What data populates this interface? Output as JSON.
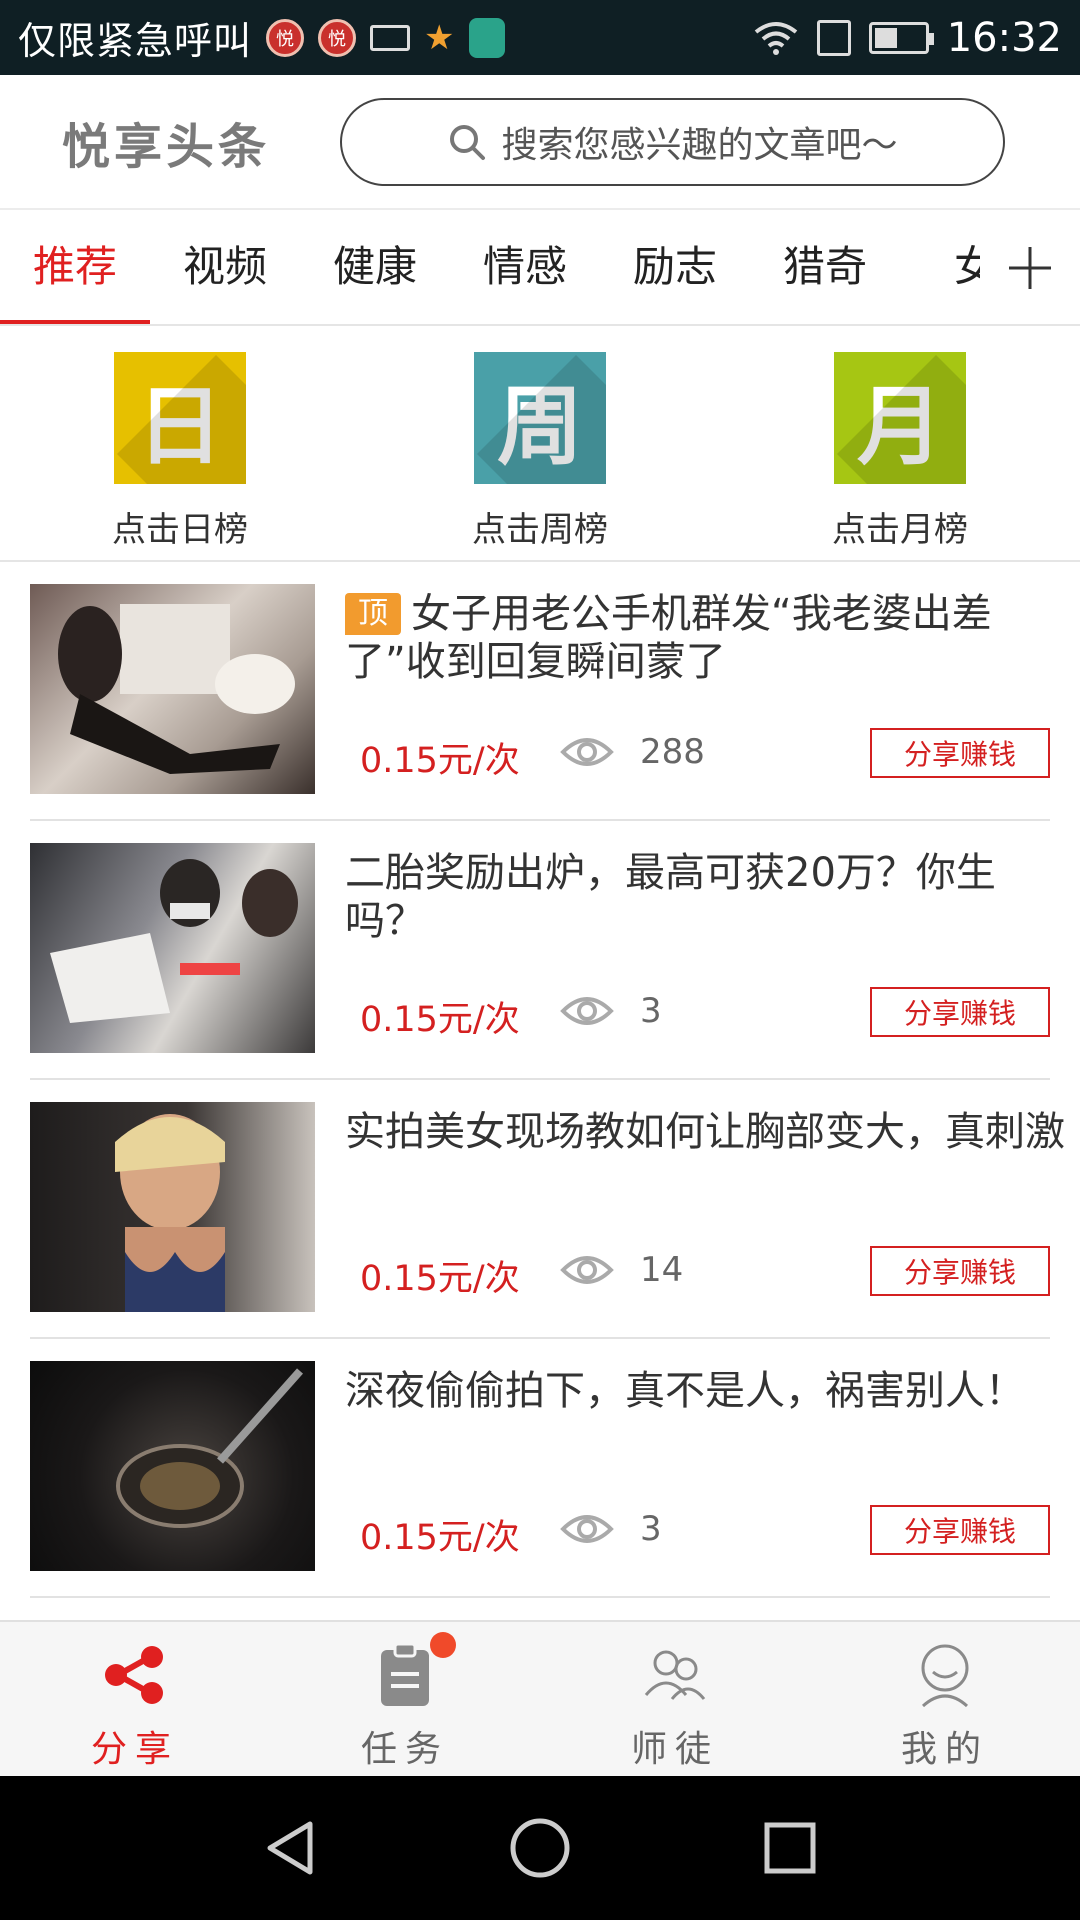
{
  "status_bar": {
    "carrier_text": "仅限紧急呼叫",
    "badge_text": "悦",
    "time": "16:32"
  },
  "header": {
    "logo": "悦享头条",
    "search_placeholder": "搜索您感兴趣的文章吧～"
  },
  "tabs": [
    "推荐",
    "视频",
    "健康",
    "情感",
    "励志",
    "猎奇",
    "女"
  ],
  "ranks": [
    {
      "glyph": "日",
      "label": "点击日榜",
      "color": "#e6c000"
    },
    {
      "glyph": "周",
      "label": "点击周榜",
      "color": "#4aa0a8"
    },
    {
      "glyph": "月",
      "label": "点击月榜",
      "color": "#a6c613"
    }
  ],
  "top_badge": "顶",
  "articles": [
    {
      "title": "女子用老公手机群发“我老婆出差了”收到回复瞬间蒙了",
      "price": "0.15元/次",
      "views": "288",
      "share": "分享赚钱",
      "pinned": true
    },
    {
      "title": "二胎奖励出炉，最高可获20万？你生吗？",
      "price": "0.15元/次",
      "views": "3",
      "share": "分享赚钱",
      "pinned": false
    },
    {
      "title": "实拍美女现场教如何让胸部变大，真刺激",
      "price": "0.15元/次",
      "views": "14",
      "share": "分享赚钱",
      "pinned": false
    },
    {
      "title": "深夜偷偷拍下，真不是人，祸害别人！",
      "price": "0.15元/次",
      "views": "3",
      "share": "分享赚钱",
      "pinned": false
    }
  ],
  "bottom_nav": [
    {
      "label": "分享",
      "icon": "share-icon",
      "active": true
    },
    {
      "label": "任务",
      "icon": "clipboard-icon",
      "active": false
    },
    {
      "label": "师徒",
      "icon": "people-icon",
      "active": false
    },
    {
      "label": "我的",
      "icon": "user-icon",
      "active": false
    }
  ],
  "colors": {
    "accent": "#e02020",
    "price": "#d42020",
    "badge": "#f29b2e"
  }
}
